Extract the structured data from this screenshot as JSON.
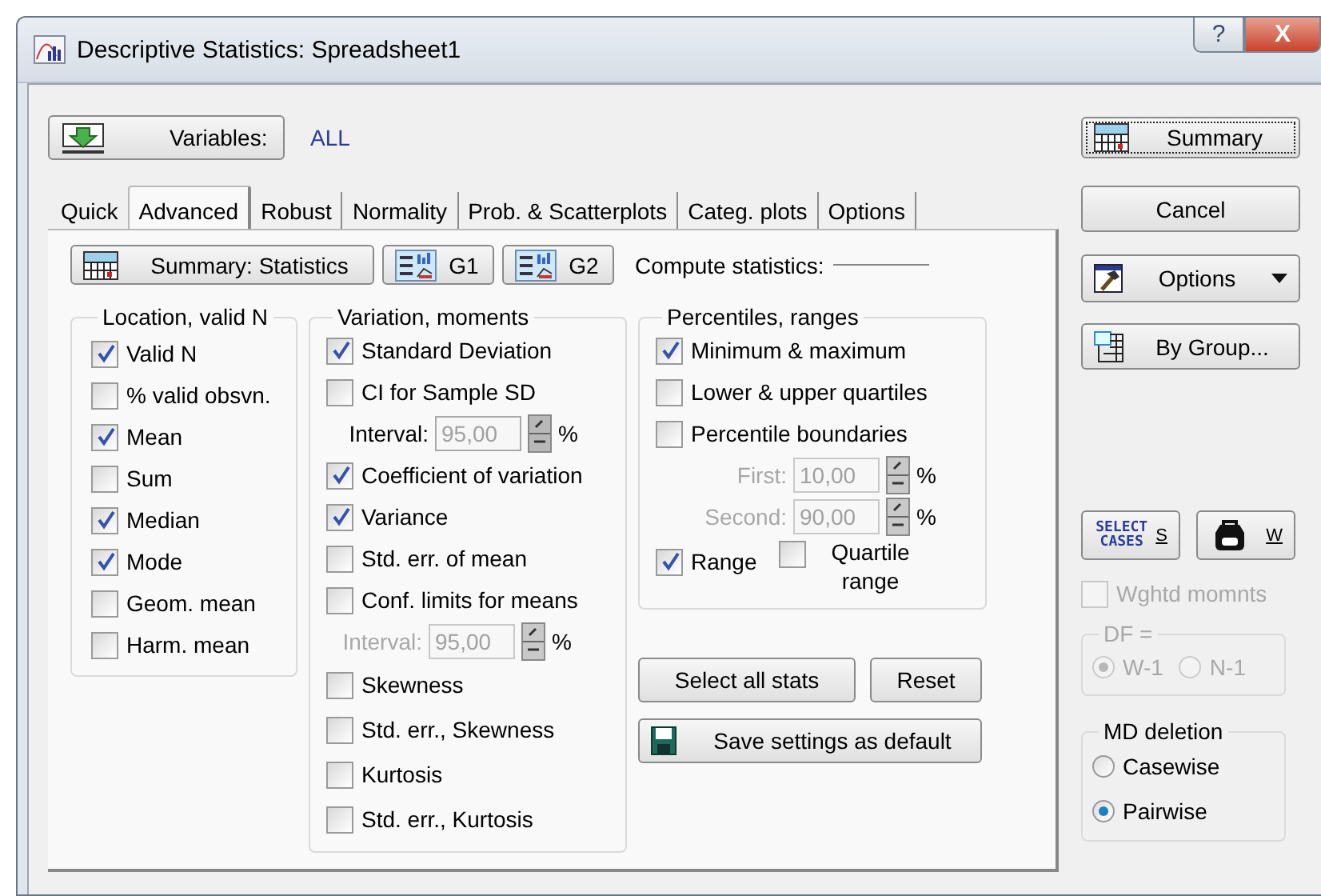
{
  "window": {
    "title": "Descriptive Statistics: Spreadsheet1",
    "help_button": "?",
    "close_button": "X"
  },
  "variables": {
    "button": "Variables:",
    "value": "ALL"
  },
  "tabs": [
    {
      "label": "Quick",
      "selected": false
    },
    {
      "label": "Advanced",
      "selected": true
    },
    {
      "label": "Robust",
      "selected": false
    },
    {
      "label": "Normality",
      "selected": false
    },
    {
      "label": "Prob. & Scatterplots",
      "selected": false
    },
    {
      "label": "Categ. plots",
      "selected": false
    },
    {
      "label": "Options",
      "selected": false
    }
  ],
  "toolbar": {
    "summary_button": "Summary: Statistics",
    "graph_buttons": [
      "G1",
      "G2"
    ],
    "compute_label": "Compute statistics:"
  },
  "groups": [
    {
      "title": "Location, valid N",
      "items": [
        {
          "kind": "checkbox",
          "label": "Valid N",
          "checked": true
        },
        {
          "kind": "checkbox",
          "label": "% valid obsvn.",
          "checked": false
        },
        {
          "kind": "checkbox",
          "label": "Mean",
          "checked": true
        },
        {
          "kind": "checkbox",
          "label": "Sum",
          "checked": false
        },
        {
          "kind": "checkbox",
          "label": "Median",
          "checked": true
        },
        {
          "kind": "checkbox",
          "label": "Mode",
          "checked": true
        },
        {
          "kind": "checkbox",
          "label": "Geom. mean",
          "checked": false
        },
        {
          "kind": "checkbox",
          "label": "Harm. mean",
          "checked": false
        }
      ]
    },
    {
      "title": "Variation, moments",
      "items": [
        {
          "kind": "checkbox",
          "label": "Standard Deviation",
          "checked": true
        },
        {
          "kind": "checkbox",
          "label": "CI for Sample SD",
          "checked": false
        },
        {
          "kind": "spin",
          "label": "Interval:",
          "value": "95,00",
          "unit": "%",
          "disabled": false
        },
        {
          "kind": "checkbox",
          "label": "Coefficient of variation",
          "checked": true
        },
        {
          "kind": "checkbox",
          "label": "Variance",
          "checked": true
        },
        {
          "kind": "checkbox",
          "label": "Std. err. of mean",
          "checked": false
        },
        {
          "kind": "checkbox",
          "label": "Conf. limits for means",
          "checked": false
        },
        {
          "kind": "spin",
          "label": "Interval:",
          "value": "95,00",
          "unit": "%",
          "disabled": true
        },
        {
          "kind": "checkbox",
          "label": "Skewness",
          "checked": false
        },
        {
          "kind": "checkbox",
          "label": "Std. err., Skewness",
          "checked": false
        },
        {
          "kind": "checkbox",
          "label": "Kurtosis",
          "checked": false
        },
        {
          "kind": "checkbox",
          "label": "Std. err., Kurtosis",
          "checked": false
        }
      ]
    },
    {
      "title": "Percentiles, ranges",
      "items": [
        {
          "kind": "checkbox",
          "label": "Minimum & maximum",
          "checked": true
        },
        {
          "kind": "checkbox",
          "label": "Lower & upper quartiles",
          "checked": false
        },
        {
          "kind": "checkbox",
          "label": "Percentile boundaries",
          "checked": false
        },
        {
          "kind": "spin",
          "label": "First:",
          "value": "10,00",
          "unit": "%",
          "disabled": true
        },
        {
          "kind": "spin",
          "label": "Second:",
          "value": "90,00",
          "unit": "%",
          "disabled": true
        },
        {
          "kind": "pair",
          "items": [
            {
              "label": "Range",
              "checked": true
            },
            {
              "label": "Quartile range",
              "checked": false
            }
          ]
        }
      ]
    }
  ],
  "select_all": "Select all stats",
  "reset": "Reset",
  "save_default": "Save settings as default",
  "side_buttons": [
    {
      "kind": "summary",
      "label": "Summary"
    },
    {
      "kind": "plain",
      "label": "Cancel"
    },
    {
      "kind": "options",
      "label": "Options"
    },
    {
      "kind": "group",
      "label": "By Group..."
    }
  ],
  "select_cases": {
    "icon_text": "SELECT CASES",
    "label": "S"
  },
  "weight_button": {
    "label": "W"
  },
  "weighted_moments": {
    "label": "Wghtd momnts",
    "checked": false,
    "disabled": true
  },
  "df": {
    "title": "DF =",
    "disabled": true,
    "options": [
      {
        "label": "W-1",
        "selected": true
      },
      {
        "label": "N-1",
        "selected": false
      }
    ]
  },
  "md_deletion": {
    "title": "MD deletion",
    "options": [
      {
        "label": "Casewise",
        "selected": false
      },
      {
        "label": "Pairwise",
        "selected": true
      }
    ]
  }
}
